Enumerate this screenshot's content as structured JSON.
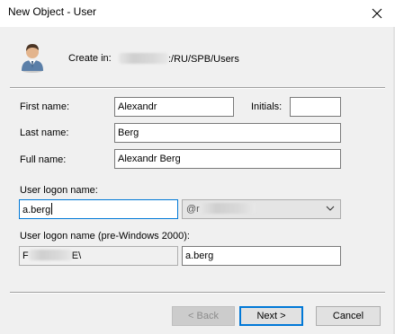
{
  "window": {
    "title": "New Object - User"
  },
  "create_in": {
    "label": "Create in:",
    "path": ":/RU/SPB/Users"
  },
  "form": {
    "first_name_label": "First name:",
    "first_name_value": "Alexandr",
    "initials_label": "Initials:",
    "initials_value": "",
    "last_name_label": "Last name:",
    "last_name_value": "Berg",
    "full_name_label": "Full name:",
    "full_name_value": "Alexandr Berg",
    "logon_label": "User logon name:",
    "logon_value": "a.berg",
    "domain_prefix": "@r",
    "pre2000_label": "User logon name (pre-Windows 2000):",
    "pre2000_domain_start": "F",
    "pre2000_domain_end": "E\\",
    "pre2000_value": "a.berg"
  },
  "buttons": {
    "back": "< Back",
    "next": "Next >",
    "cancel": "Cancel"
  },
  "icons": {
    "close": "close-icon",
    "user": "user-icon",
    "dropdown": "chevron-down-icon"
  },
  "colors": {
    "focus": "#0078d7",
    "background": "#f0f0f0"
  }
}
